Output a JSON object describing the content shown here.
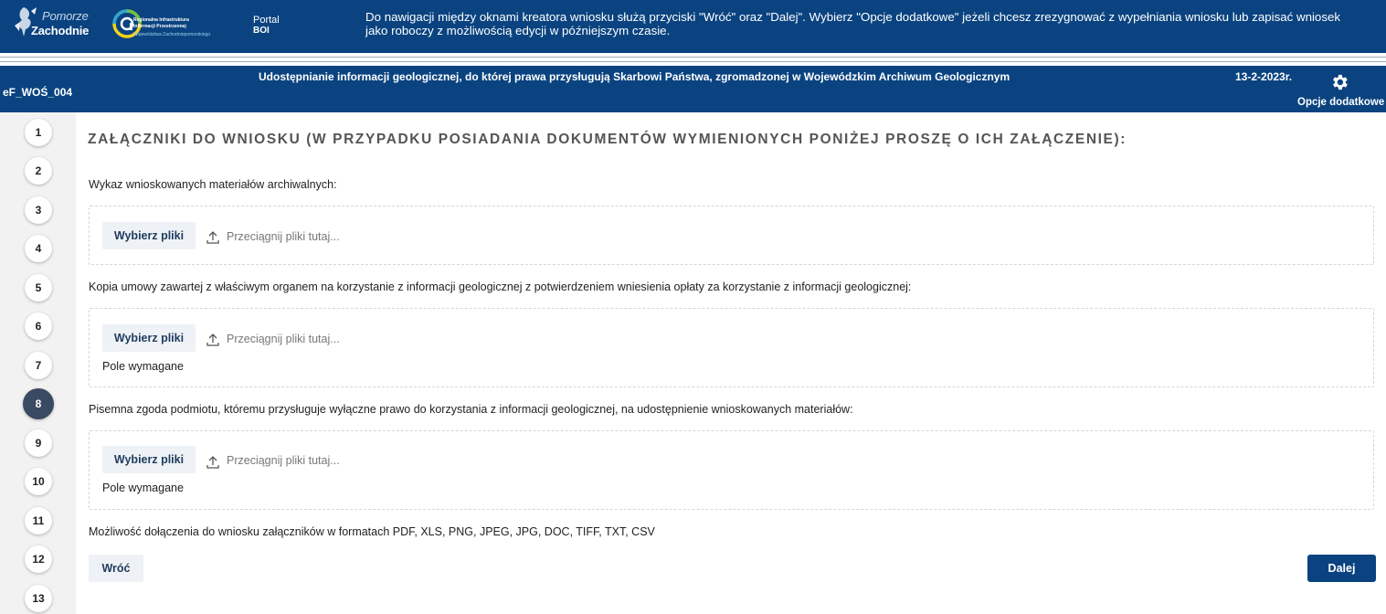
{
  "header": {
    "logo_pz_line1": "Pomorze",
    "logo_pz_line2": "Zachodnie",
    "logo_riip_line1": "Regionalna Infrastruktura",
    "logo_riip_line2": "Informacji Przestrzennej",
    "logo_riip_line3": "Województwa Zachodniopomorskiego",
    "portal_label": "Portal",
    "portal_name": "BOI",
    "info_text": "Do nawigacji między oknami kreatora wniosku służą przyciski \"Wróć\" oraz \"Dalej\". Wybierz \"Opcje dodatkowe\" jeżeli chcesz zrezygnować z wypełniania wniosku lub zapisać wniosek jako roboczy z możliwością edycji w późniejszym czasie."
  },
  "titlebar": {
    "form_code": "eF_WOŚ_004",
    "title": "Udostępnianie informacji geologicznej, do której prawa przysługują Skarbowi Państwa, zgromadzonej w Wojewódzkim Archiwum Geologicznym",
    "date": "13-2-2023r.",
    "options_label": "Opcje dodatkowe",
    "options_icon": "gear-icon"
  },
  "steps": {
    "items": [
      "1",
      "2",
      "3",
      "4",
      "5",
      "6",
      "7",
      "8",
      "9",
      "10",
      "11",
      "12",
      "13"
    ],
    "active": "8"
  },
  "main": {
    "heading": "ZAŁĄCZNIKI DO WNIOSKU (W PRZYPADKU POSIADANIA DOKUMENTÓW WYMIENIONYCH PONIŻEJ PROSZĘ O ICH ZAŁĄCZENIE):",
    "fields": [
      {
        "label": "Wykaz wnioskowanych materiałów archiwalnych:",
        "pick_button": "Wybierz pliki",
        "drop_hint": "Przeciągnij pliki tutaj...",
        "required_text": ""
      },
      {
        "label": "Kopia umowy zawartej z właściwym organem na korzystanie z informacji geologicznej z potwierdzeniem wniesienia opłaty za korzystanie z informacji geologicznej:",
        "pick_button": "Wybierz pliki",
        "drop_hint": "Przeciągnij pliki tutaj...",
        "required_text": "Pole wymagane"
      },
      {
        "label": "Pisemna zgoda podmiotu, któremu przysługuje wyłączne prawo do korzystania z informacji geologicznej, na udostępnienie wnioskowanych materiałów:",
        "pick_button": "Wybierz pliki",
        "drop_hint": "Przeciągnij pliki tutaj...",
        "required_text": "Pole wymagane"
      }
    ],
    "formats_note": "Możliwość dołączenia do wniosku załączników w formatach PDF, XLS, PNG, JPEG, JPG, DOC, TIFF, TXT, CSV",
    "back_button": "Wróć",
    "next_button": "Dalej"
  },
  "colors": {
    "brand_blue": "#0a4380",
    "active_step": "#3a4a62",
    "sidebar_bg": "#f2f2f2"
  }
}
